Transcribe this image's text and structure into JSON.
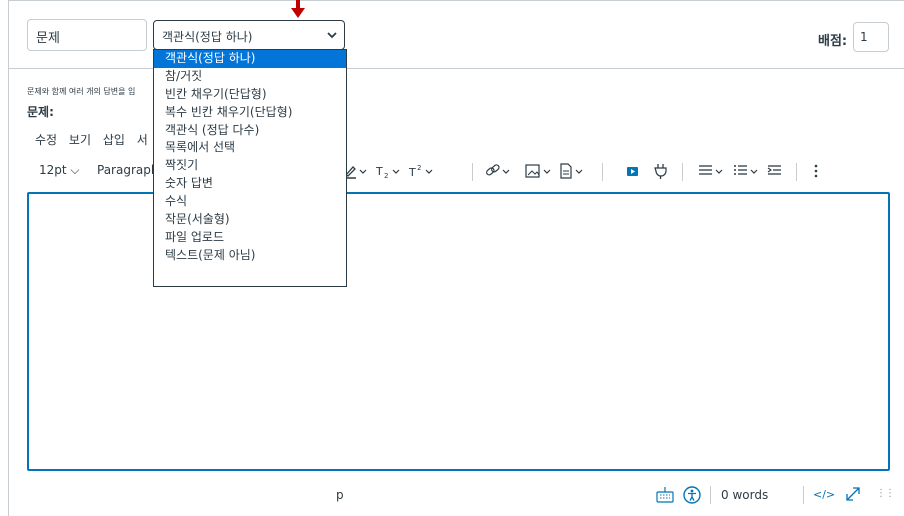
{
  "question": {
    "title_value": "문제",
    "type_select_value": "객관식(정답 하나)",
    "points_label": "배점:",
    "points_value": "1",
    "helper_text": "문제와 함께 여러 개의 답변을 입",
    "question_label": "문제:"
  },
  "type_options": [
    "객관식(정답 하나)",
    "참/거짓",
    "빈칸 채우기(단답형)",
    "복수 빈칸 채우기(단답형)",
    "객관식 (정답 다수)",
    "목록에서 선택",
    "짝짓기",
    "숫자 답변",
    "수식",
    "작문(서술형)",
    "파일 업로드",
    "텍스트(문제 아님)"
  ],
  "selected_option_index": 0,
  "editor": {
    "menu": [
      "수정",
      "보기",
      "삽입",
      "서"
    ],
    "toolbar": {
      "font_size": "12pt",
      "block_format": "Paragraph"
    },
    "status": {
      "path": "p",
      "word_count": "0 words",
      "html_toggle": "</>"
    }
  },
  "colors": {
    "accent": "#0374b5",
    "selected_bg": "#0374d8",
    "arrow": "#c00000",
    "border": "#c7cdd1",
    "text": "#2d3b45"
  }
}
